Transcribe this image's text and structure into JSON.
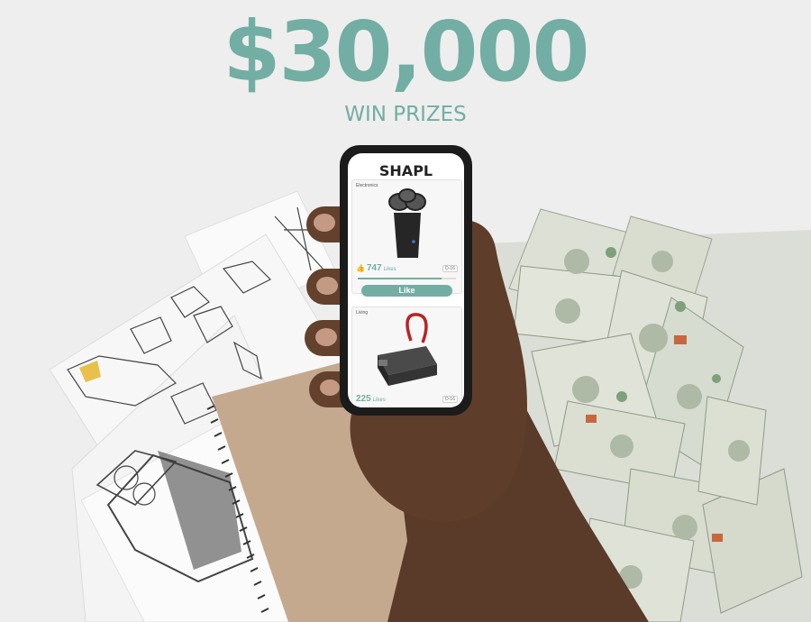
{
  "headline": {
    "amount": "$30,000",
    "subtitle": "WIN PRIZES"
  },
  "colors": {
    "accent": "#72aea3",
    "kraft": "#c4a98e",
    "skin": "#5a3a28",
    "money": "#d9ddd0"
  },
  "app": {
    "name": "SHAPL",
    "cards": [
      {
        "category": "Electronics",
        "likes": "747",
        "likes_label": "Likes",
        "tag": "D-16",
        "progress": 0.85,
        "button": "Like",
        "icon": "electric-shaver-icon"
      },
      {
        "category": "Living",
        "likes": "225",
        "likes_label": "Likes",
        "tag": "D-16",
        "icon": "power-bank-icon"
      }
    ]
  }
}
